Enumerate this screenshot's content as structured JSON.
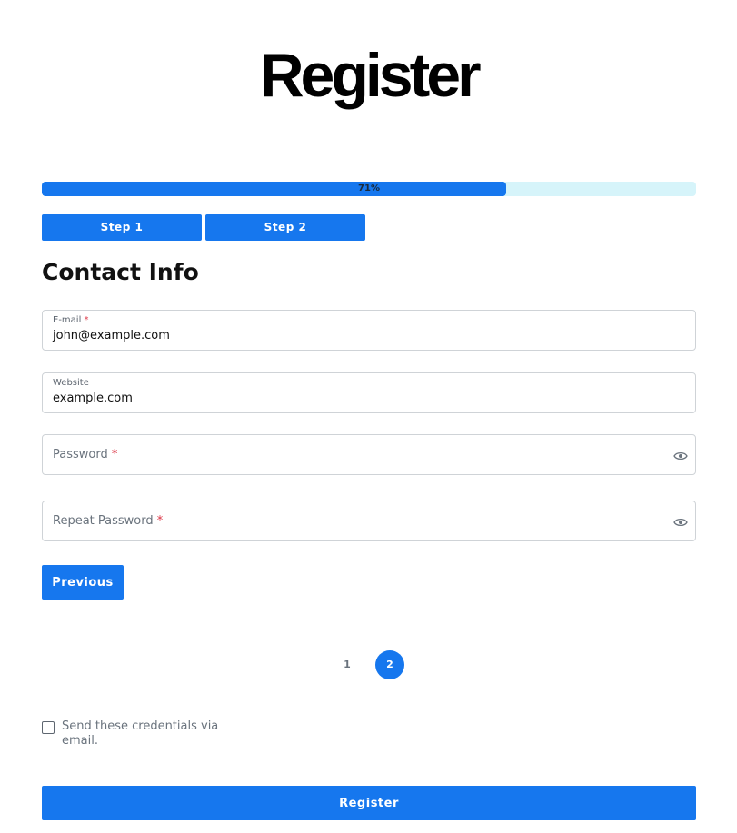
{
  "page": {
    "title": "Register"
  },
  "progress": {
    "value": 0.71,
    "label": "71%"
  },
  "steps": [
    {
      "label": "Step 1"
    },
    {
      "label": "Step 2"
    }
  ],
  "section": {
    "title": "Contact Info"
  },
  "fields": {
    "email": {
      "label": "E-mail",
      "required_mark": "*",
      "value": "john@example.com"
    },
    "website": {
      "label": "Website",
      "value": "example.com"
    },
    "password": {
      "label": "Password",
      "required_mark": "*",
      "icon": "eye-icon"
    },
    "repeat_password": {
      "label": "Repeat Password",
      "required_mark": "*",
      "icon": "eye-icon"
    }
  },
  "buttons": {
    "previous": "Previous",
    "register": "Register"
  },
  "pagination": {
    "pages": [
      "1",
      "2"
    ],
    "current": "2"
  },
  "checkbox": {
    "label": "Send these credentials via email.",
    "checked": false
  },
  "colors": {
    "accent": "#1677ee",
    "progress_track": "#d6f4fa",
    "required": "#dc3545"
  }
}
